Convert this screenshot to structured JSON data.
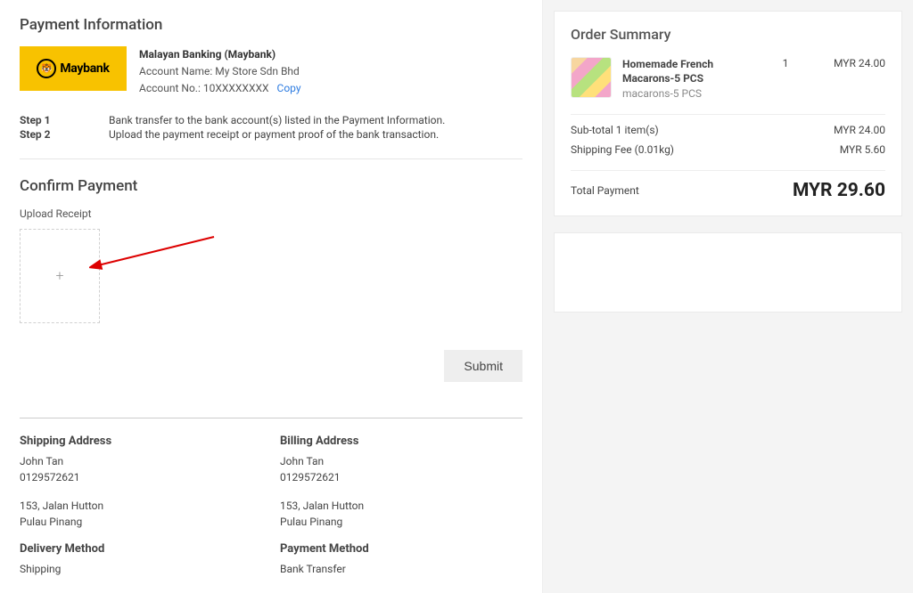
{
  "payment_info": {
    "title": "Payment Information",
    "bank_logo_text": "Maybank",
    "bank_name": "Malayan Banking (Maybank)",
    "account_name_label": "Account Name: ",
    "account_name": "My Store Sdn Bhd",
    "account_no_label": "Account No.: ",
    "account_no": "10XXXXXXXX",
    "copy_label": "Copy",
    "step1_label": "Step 1",
    "step1_text": "Bank transfer to the bank account(s) listed in the Payment Information.",
    "step2_label": "Step 2",
    "step2_text": "Upload the payment receipt or payment proof of the bank transaction."
  },
  "confirm": {
    "title": "Confirm Payment",
    "upload_label": "Upload Receipt",
    "plus": "+",
    "submit": "Submit"
  },
  "shipping": {
    "heading": "Shipping Address",
    "name": "John Tan",
    "phone": "0129572621",
    "line1": "153, Jalan Hutton",
    "line2": "Pulau Pinang",
    "delivery_heading": "Delivery Method",
    "delivery_value": "Shipping"
  },
  "billing": {
    "heading": "Billing Address",
    "name": "John Tan",
    "phone": "0129572621",
    "line1": "153, Jalan Hutton",
    "line2": "Pulau Pinang",
    "payment_heading": "Payment Method",
    "payment_value": "Bank Transfer"
  },
  "summary": {
    "title": "Order Summary",
    "item": {
      "name": "Homemade French Macarons-5 PCS",
      "sku": "macarons-5 PCS",
      "qty": "1",
      "price": "MYR 24.00"
    },
    "subtotal_label": "Sub-total 1 item(s)",
    "subtotal_value": "MYR 24.00",
    "shipping_label": "Shipping Fee (0.01kg)",
    "shipping_value": "MYR 5.60",
    "total_label": "Total Payment",
    "total_value": "MYR 29.60"
  }
}
